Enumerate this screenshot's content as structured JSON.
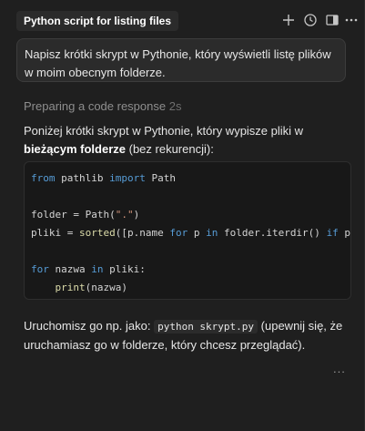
{
  "header": {
    "title": "Python script for listing files",
    "icons": [
      "plus-icon",
      "history-icon",
      "sidebar-toggle-icon",
      "more-icon"
    ]
  },
  "user_message": "Napisz krótki skrypt w Pythonie, który wyświetli listę plików w moim obecnym folderze.",
  "status": {
    "label": "Preparing a code response",
    "time": "2s"
  },
  "response": {
    "intro_start": "Poniżej krótki skrypt w Pythonie, który wypisze pliki w ",
    "intro_bold": "bieżącym folderze",
    "intro_end": " (bez rekurencji):",
    "code_lines": [
      "from pathlib import Path",
      "",
      "folder = Path(\".\")",
      "pliki = sorted([p.name for p in folder.iterdir() if p.",
      "",
      "for nazwa in pliki:",
      "    print(nazwa)"
    ],
    "outro_start": "Uruchomisz go np. jako: ",
    "outro_code": "python skrypt.py",
    "outro_end": " (upewnij się, że uruchamiasz go w folderze, który chcesz przeglądać)."
  },
  "more_label": "..."
}
